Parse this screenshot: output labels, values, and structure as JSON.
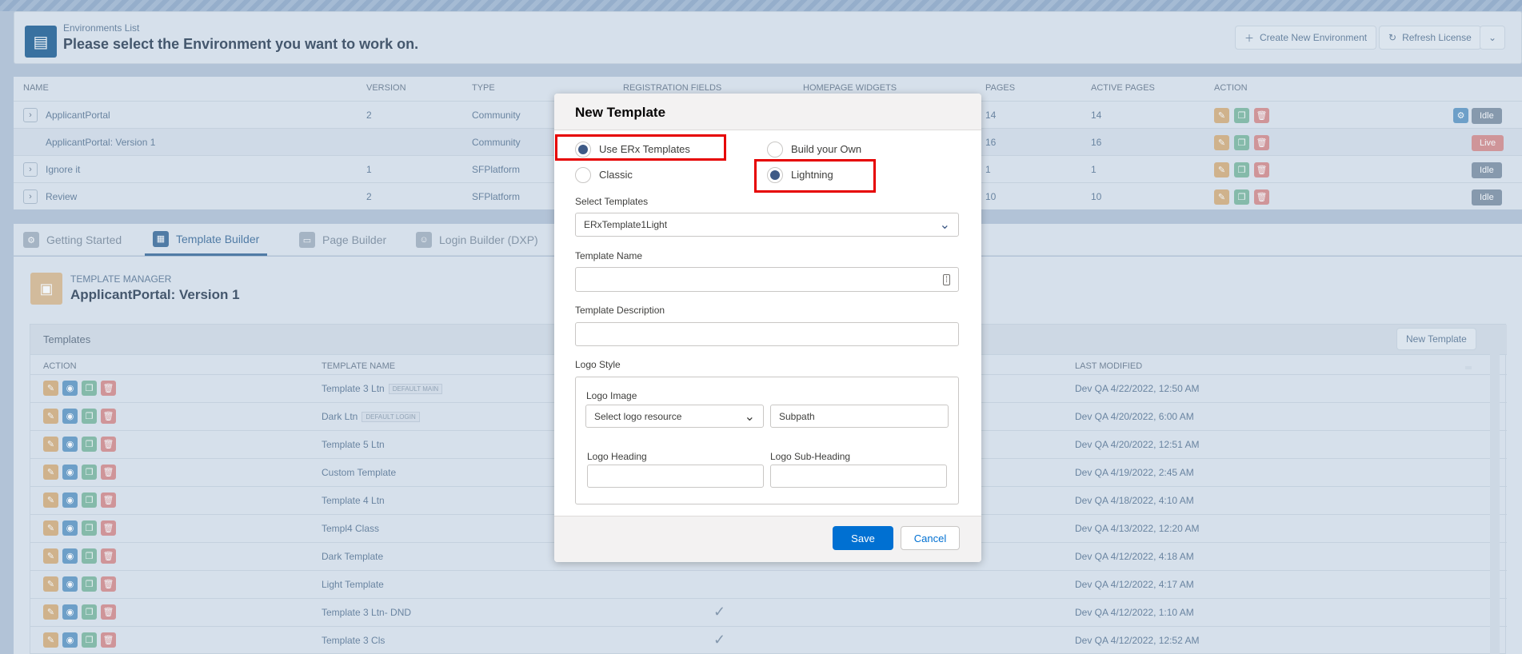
{
  "header": {
    "subtitle": "Environments List",
    "title": "Please select the Environment you want to work on.",
    "create_label": "Create New Environment",
    "refresh_label": "Refresh License"
  },
  "env_table": {
    "columns": [
      "NAME",
      "VERSION",
      "TYPE",
      "REGISTRATION FIELDS",
      "HOMEPAGE WIDGETS",
      "PAGES",
      "ACTIVE PAGES",
      "ACTION"
    ],
    "rows": [
      {
        "name": "ApplicantPortal",
        "version": "2",
        "type": "Community",
        "pages": "14",
        "active": "14",
        "status": "Idle"
      },
      {
        "name": "ApplicantPortal: Version 1",
        "version": "",
        "type": "Community",
        "pages": "16",
        "active": "16",
        "status": "Live"
      },
      {
        "name": "Ignore it",
        "version": "1",
        "type": "SFPlatform",
        "pages": "1",
        "active": "1",
        "status": "Idle"
      },
      {
        "name": "Review",
        "version": "2",
        "type": "SFPlatform",
        "pages": "10",
        "active": "10",
        "status": "Idle"
      }
    ]
  },
  "tabs": [
    "Getting Started",
    "Template Builder",
    "Page Builder",
    "Login Builder (DXP)"
  ],
  "template_manager": {
    "subtitle": "TEMPLATE MANAGER",
    "title": "ApplicantPortal: Version 1",
    "panel_title": "Templates",
    "new_template_label": "New Template",
    "columns": [
      "ACTION",
      "TEMPLATE NAME",
      "LAST MODIFIED"
    ],
    "rows": [
      {
        "name": "Template 3 Ltn",
        "tag": "DEFAULT MAIN",
        "modified": "Dev QA  4/22/2022, 12:50 AM",
        "check": ""
      },
      {
        "name": "Dark Ltn",
        "tag": "DEFAULT LOGIN",
        "modified": "Dev QA  4/20/2022, 6:00 AM",
        "check": ""
      },
      {
        "name": "Template 5 Ltn",
        "tag": "",
        "modified": "Dev QA  4/20/2022, 12:51 AM",
        "check": ""
      },
      {
        "name": "Custom Template",
        "tag": "",
        "modified": "Dev QA  4/19/2022, 2:45 AM",
        "check": ""
      },
      {
        "name": "Template 4 Ltn",
        "tag": "",
        "modified": "Dev QA  4/18/2022, 4:10 AM",
        "check": ""
      },
      {
        "name": "Templ4 Class",
        "tag": "",
        "modified": "Dev QA  4/13/2022, 12:20 AM",
        "check": ""
      },
      {
        "name": "Dark Template",
        "tag": "",
        "modified": "Dev QA  4/12/2022, 4:18 AM",
        "check": ""
      },
      {
        "name": "Light Template",
        "tag": "",
        "modified": "Dev QA  4/12/2022, 4:17 AM",
        "check": ""
      },
      {
        "name": "Template 3 Ltn- DND",
        "tag": "",
        "modified": "Dev QA  4/12/2022, 1:10 AM",
        "check": "✓"
      },
      {
        "name": "Template 3 Cls",
        "tag": "",
        "modified": "Dev QA  4/12/2022, 12:52 AM",
        "check": "✓"
      }
    ]
  },
  "modal": {
    "title": "New Template",
    "opt_use_erx": "Use ERx Templates",
    "opt_build_own": "Build your Own",
    "opt_classic": "Classic",
    "opt_lightning": "Lightning",
    "select_templates_label": "Select Templates",
    "select_templates_value": "ERxTemplate1Light",
    "template_name_label": "Template Name",
    "template_name_value": "",
    "template_desc_label": "Template Description",
    "template_desc_value": "",
    "logo_style_label": "Logo Style",
    "logo_image_label": "Logo Image",
    "logo_resource_value": "Select logo resource",
    "subpath_placeholder": "Subpath",
    "logo_heading_label": "Logo Heading",
    "logo_subheading_label": "Logo Sub-Heading",
    "save_label": "Save",
    "cancel_label": "Cancel"
  }
}
